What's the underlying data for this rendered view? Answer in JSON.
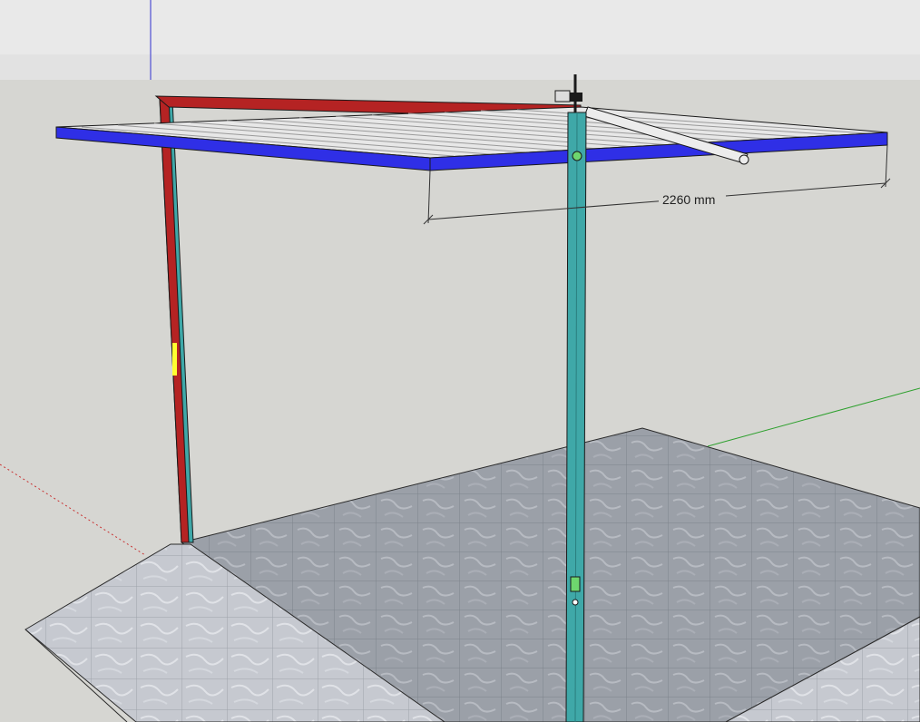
{
  "dimension": {
    "label": "2260 mm"
  },
  "colors": {
    "sky": "#e6e6e6",
    "ground": "#d6d6d2",
    "roof_frame": "#2f2fe6",
    "roof_slats": "#e8e8e8",
    "beam": "#b52323",
    "post": "#3fa8a8",
    "floor": "#9a9ea6",
    "stair_tread": "#c9ccd3",
    "axis_red": "#c83232",
    "axis_green": "#2ea02e",
    "axis_blue": "#3030d0",
    "highlight": "#ffff30"
  },
  "icons": [
    "post-bracket-icon",
    "mount-head-icon"
  ]
}
